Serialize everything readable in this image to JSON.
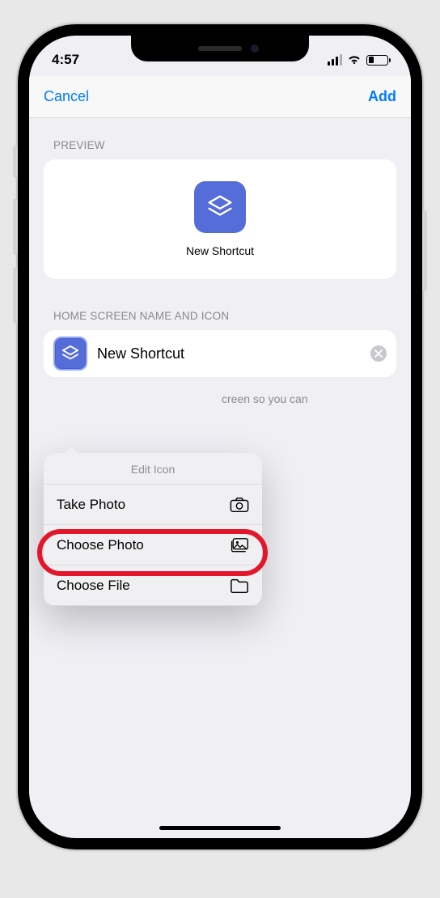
{
  "status": {
    "time": "4:57"
  },
  "nav": {
    "cancel": "Cancel",
    "add": "Add"
  },
  "preview": {
    "section_label": "PREVIEW",
    "shortcut_name": "New Shortcut"
  },
  "home": {
    "section_label": "HOME SCREEN NAME AND ICON",
    "input_value": "New Shortcut",
    "hint_fragment": "creen so you can"
  },
  "popover": {
    "title": "Edit Icon",
    "items": [
      {
        "label": "Take Photo"
      },
      {
        "label": "Choose Photo"
      },
      {
        "label": "Choose File"
      }
    ]
  }
}
